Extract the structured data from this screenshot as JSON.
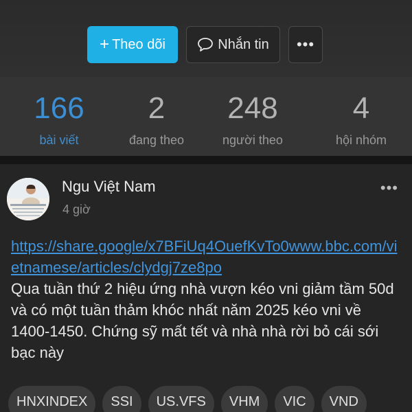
{
  "actions": {
    "follow_plus": "+",
    "follow_label": "Theo dõi",
    "message_label": "Nhắn tin",
    "more_label": "•••"
  },
  "stats": [
    {
      "value": "166",
      "label": "bài viết"
    },
    {
      "value": "2",
      "label": "đang theo"
    },
    {
      "value": "248",
      "label": "người theo"
    },
    {
      "value": "4",
      "label": "hội nhóm"
    }
  ],
  "post": {
    "author": "Ngu Việt Nam",
    "time": "4 giờ",
    "more_label": "•••",
    "link": "https://share.google/x7BFiUq4OuefKvTo0www.bbc.com/vietnamese/articles/clydgj7ze8po",
    "body": "Qua tuần thứ 2 hiệu ứng nhà vượn kéo vni giảm tầm 50d và có một tuần thảm khóc nhất năm 2025 kéo vni về 1400-1450. Chứng sỹ mất tết và nhà nhà rời bỏ cái sới bạc này",
    "tags": [
      "HNXINDEX",
      "SSI",
      "US.VFS",
      "VHM",
      "VIC",
      "VND"
    ]
  },
  "colors": {
    "accent": "#1fb1e5",
    "link": "#3f94dd",
    "active_stat": "#3a8fd6"
  },
  "icons": {
    "message": "chat-bubble-icon",
    "more": "more-dots-icon"
  }
}
